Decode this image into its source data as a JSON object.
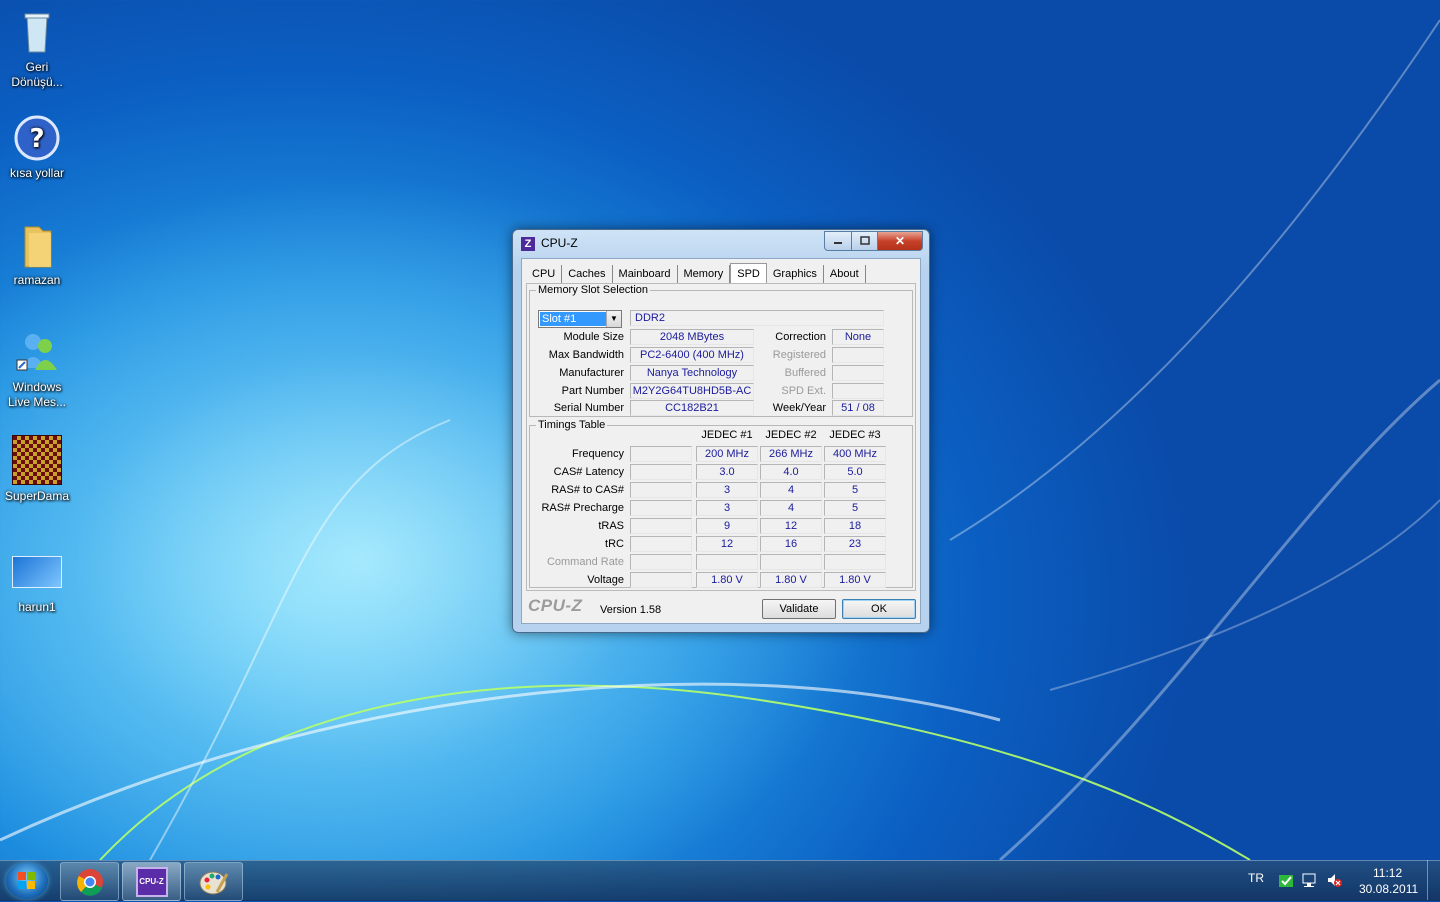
{
  "desktop": {
    "icons": [
      {
        "label": "Geri Dönüşü..."
      },
      {
        "label": "kısa yollar"
      },
      {
        "label": "ramazan"
      },
      {
        "label": "Windows Live Mes..."
      },
      {
        "label": "SuperDama"
      },
      {
        "label": "harun1"
      }
    ]
  },
  "window": {
    "title": "CPU-Z",
    "icon_letter": "Z",
    "close_glyph": "✕",
    "tabs": [
      {
        "label": "CPU"
      },
      {
        "label": "Caches"
      },
      {
        "label": "Mainboard"
      },
      {
        "label": "Memory"
      },
      {
        "label": "SPD",
        "active": true
      },
      {
        "label": "Graphics"
      },
      {
        "label": "About"
      }
    ],
    "slot_section": {
      "title": "Memory Slot Selection",
      "slot_value": "Slot #1",
      "memory_type": "DDR2",
      "module_size_label": "Module Size",
      "module_size": "2048 MBytes",
      "max_bandwidth_label": "Max Bandwidth",
      "max_bandwidth": "PC2-6400 (400 MHz)",
      "manufacturer_label": "Manufacturer",
      "manufacturer": "Nanya Technology",
      "part_number_label": "Part Number",
      "part_number": "M2Y2G64TU8HD5B-AC",
      "serial_number_label": "Serial Number",
      "serial_number": "CC182B21",
      "correction_label": "Correction",
      "correction": "None",
      "registered_label": "Registered",
      "registered": "",
      "buffered_label": "Buffered",
      "buffered": "",
      "spd_ext_label": "SPD Ext.",
      "spd_ext": "",
      "week_year_label": "Week/Year",
      "week_year": "51 / 08"
    },
    "timings": {
      "title": "Timings Table",
      "columns": [
        "JEDEC #1",
        "JEDEC #2",
        "JEDEC #3"
      ],
      "rows": [
        {
          "label": "Frequency",
          "values": [
            "200 MHz",
            "266 MHz",
            "400 MHz"
          ]
        },
        {
          "label": "CAS# Latency",
          "values": [
            "3.0",
            "4.0",
            "5.0"
          ]
        },
        {
          "label": "RAS# to CAS#",
          "values": [
            "3",
            "4",
            "5"
          ]
        },
        {
          "label": "RAS# Precharge",
          "values": [
            "3",
            "4",
            "5"
          ]
        },
        {
          "label": "tRAS",
          "values": [
            "9",
            "12",
            "18"
          ]
        },
        {
          "label": "tRC",
          "values": [
            "12",
            "16",
            "23"
          ]
        },
        {
          "label": "Command Rate",
          "values": [
            "",
            "",
            ""
          ],
          "dim": true
        },
        {
          "label": "Voltage",
          "values": [
            "1.80 V",
            "1.80 V",
            "1.80 V"
          ]
        }
      ]
    },
    "footer": {
      "logo": "CPU-Z",
      "version": "Version 1.58",
      "validate_label": "Validate",
      "ok_label": "OK"
    }
  },
  "taskbar": {
    "language": "TR",
    "time": "11:12",
    "date": "30.08.2011",
    "cpuz_icon_text": "CPU-Z"
  }
}
